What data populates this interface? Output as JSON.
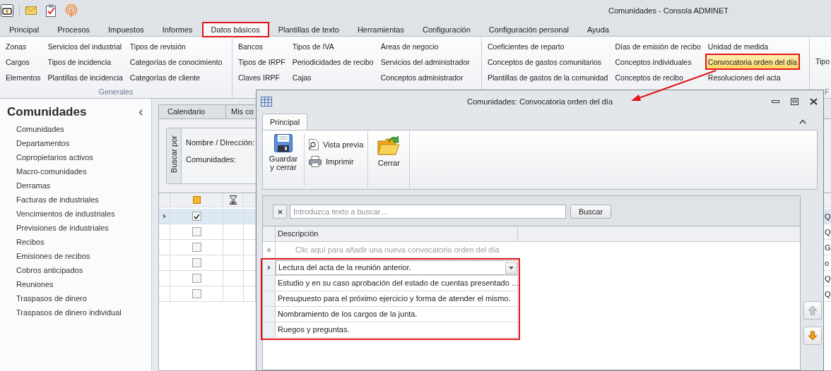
{
  "window": {
    "title": "Comunidades - Consola ADMINET"
  },
  "ribbon_tabs": [
    {
      "label": "Principal",
      "selected": false,
      "annotated": false
    },
    {
      "label": "Procesos",
      "selected": false,
      "annotated": false
    },
    {
      "label": "Impuestos",
      "selected": false,
      "annotated": false
    },
    {
      "label": "Informes",
      "selected": false,
      "annotated": false
    },
    {
      "label": "Datos básicos",
      "selected": true,
      "annotated": true
    },
    {
      "label": "Plantillas de texto",
      "selected": false,
      "annotated": false
    },
    {
      "label": "Herramientas",
      "selected": false,
      "annotated": false
    },
    {
      "label": "Configuración",
      "selected": false,
      "annotated": false
    },
    {
      "label": "Configuración personal",
      "selected": false,
      "annotated": false
    },
    {
      "label": "Ayuda",
      "selected": false,
      "annotated": false
    }
  ],
  "ribbon_groups": [
    {
      "label": "Generales",
      "columns": [
        [
          {
            "label": "Zonas",
            "selected": false,
            "annotated": false
          },
          {
            "label": "Cargos",
            "selected": false,
            "annotated": false
          },
          {
            "label": "Elementos",
            "selected": false,
            "annotated": false
          }
        ],
        [
          {
            "label": "Servicios del industrial",
            "selected": false,
            "annotated": false
          },
          {
            "label": "Tipos de incidencia",
            "selected": false,
            "annotated": false
          },
          {
            "label": "Plantillas de incidencia",
            "selected": false,
            "annotated": false
          }
        ],
        [
          {
            "label": "Tipos de revisión",
            "selected": false,
            "annotated": false
          },
          {
            "label": "Categorías de conocimiento",
            "selected": false,
            "annotated": false
          },
          {
            "label": "Categorías de cliente",
            "selected": false,
            "annotated": false
          }
        ]
      ]
    },
    {
      "columns": [
        [
          {
            "label": "Bancos",
            "selected": false,
            "annotated": false
          },
          {
            "label": "Tipos de IRPF",
            "selected": false,
            "annotated": false
          },
          {
            "label": "Claves IRPF",
            "selected": false,
            "annotated": false
          }
        ],
        [
          {
            "label": "Tipos de IVA",
            "selected": false,
            "annotated": false
          },
          {
            "label": "Periodicidades de recibo",
            "selected": false,
            "annotated": false
          },
          {
            "label": "Cajas",
            "selected": false,
            "annotated": false
          }
        ],
        [
          {
            "label": "Áreas de negocio",
            "selected": false,
            "annotated": false
          },
          {
            "label": "Servicios del administrador",
            "selected": false,
            "annotated": false
          },
          {
            "label": "Conceptos administrador",
            "selected": false,
            "annotated": false
          }
        ]
      ]
    },
    {
      "columns": [
        [
          {
            "label": "Coeficientes de reparto",
            "selected": false,
            "annotated": false
          },
          {
            "label": "Conceptos de gastos comunitarios",
            "selected": false,
            "annotated": false
          },
          {
            "label": "Plantillas de gastos de la comunidad",
            "selected": false,
            "annotated": false
          }
        ],
        [
          {
            "label": "Días de emisión de recibo",
            "selected": false,
            "annotated": false
          },
          {
            "label": "Conceptos individuales",
            "selected": false,
            "annotated": false
          },
          {
            "label": "Conceptos de recibo",
            "selected": false,
            "annotated": false
          }
        ],
        [
          {
            "label": "Unidad de medida",
            "selected": false,
            "annotated": false
          },
          {
            "label": "Convocatoria orden del día",
            "selected": true,
            "annotated": true
          },
          {
            "label": "Resoluciones del acta",
            "selected": false,
            "annotated": false
          }
        ]
      ]
    },
    {
      "label": "F",
      "columns": [
        [
          {
            "label": "Tipo",
            "selected": false,
            "annotated": false
          }
        ]
      ]
    }
  ],
  "sidebar": {
    "title": "Comunidades",
    "items": [
      "Comunidades",
      "Departamentos",
      "Copropietarios activos",
      "Macro-comunidades",
      "Derramas",
      "Facturas de industriales",
      "Vencimientos de industriales",
      "Previsiones de industriales",
      "Recibos",
      "Emisiones de recibos",
      "Cobros anticipados",
      "Reuniones",
      "Traspasos de dinero",
      "Traspasos de dinero individual"
    ]
  },
  "content": {
    "tabs": [
      "Calendario",
      "Mis co"
    ],
    "search": {
      "group_label": "Buscar por",
      "fields": [
        "Nombre / Dirección:",
        "Comunidades:"
      ]
    },
    "grid": {
      "rows": [
        {
          "checked": true,
          "selected": true,
          "column_3": "Q"
        },
        {
          "checked": false,
          "selected": false,
          "column_3": "Q"
        },
        {
          "checked": false,
          "selected": false,
          "column_3": "G"
        },
        {
          "checked": false,
          "selected": false,
          "column_3": "o"
        },
        {
          "checked": false,
          "selected": false,
          "column_3": "Q"
        },
        {
          "checked": false,
          "selected": false,
          "column_3": "Q"
        }
      ]
    }
  },
  "dialog": {
    "title": "Comunidades: Convocatoria orden del día",
    "tabs": [
      {
        "label": "Principal",
        "selected": true
      }
    ],
    "buttons": [
      {
        "label": "Guardar y cerrar",
        "kind": "large"
      },
      {
        "label": "Vista previa",
        "kind": "small"
      },
      {
        "label": "Imprimir",
        "kind": "small"
      },
      {
        "label": "Cerrar",
        "kind": "large"
      }
    ],
    "search": {
      "placeholder": "Introduzca texto a buscar…",
      "button": "Buscar"
    },
    "grid": {
      "columns": [
        "Descripción"
      ],
      "new_row_hint": "Clic aquí para añadir una nueva convocatoria orden del día",
      "annotated": true,
      "rows": [
        {
          "text": "Lectura del acta de la reunión anterior.",
          "selected": true
        },
        {
          "text": "Estudio y en su caso aprobación del estado de cuentas presentado …",
          "selected": false
        },
        {
          "text": "Presupuesto para el próximo ejercicio y forma de atender el mismo.",
          "selected": false
        },
        {
          "text": "Nombramiento de los cargos de la junta.",
          "selected": false
        },
        {
          "text": "Ruegos y preguntas.",
          "selected": false
        }
      ]
    }
  },
  "annotation_arrow": true
}
